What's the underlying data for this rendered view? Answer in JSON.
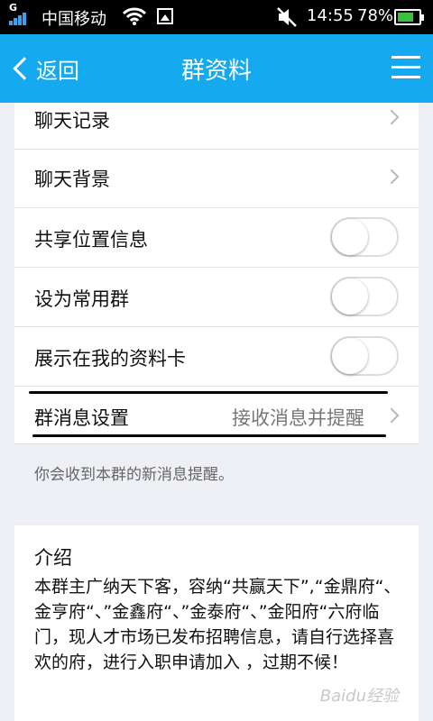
{
  "status_bar": {
    "g_label": "G",
    "carrier": "中国移动",
    "time": "14:55",
    "battery_percent": "78%",
    "battery_level": 0.78,
    "icons": [
      "signal-icon",
      "wifi-icon",
      "image-icon",
      "mute-icon",
      "battery-icon"
    ]
  },
  "nav": {
    "back_label": "返回",
    "title": "群资料",
    "menu_icon": "menu-icon"
  },
  "settings": {
    "chat_history": "聊天记录",
    "chat_background": "聊天背景",
    "share_location": "共享位置信息",
    "share_location_on": false,
    "set_frequent": "设为常用群",
    "set_frequent_on": false,
    "show_on_card": "展示在我的资料卡",
    "show_on_card_on": false,
    "message_settings": "群消息设置",
    "message_settings_value": "接收消息并提醒"
  },
  "hint": "你会收到本群的新消息提醒。",
  "intro": {
    "heading": "介绍",
    "body": "本群主广纳天下客，容纳“共赢天下”,“金鼎府“、金亨府“、”金鑫府“、”金泰府“、”金阳府“六府临门，现人才市场已发布招聘信息，请自行选择喜欢的府，进行入职申请加入 ，过期不候！"
  },
  "watermark": "Baidu经验",
  "colors": {
    "accent": "#15a9ef",
    "background": "#eff0f5"
  }
}
